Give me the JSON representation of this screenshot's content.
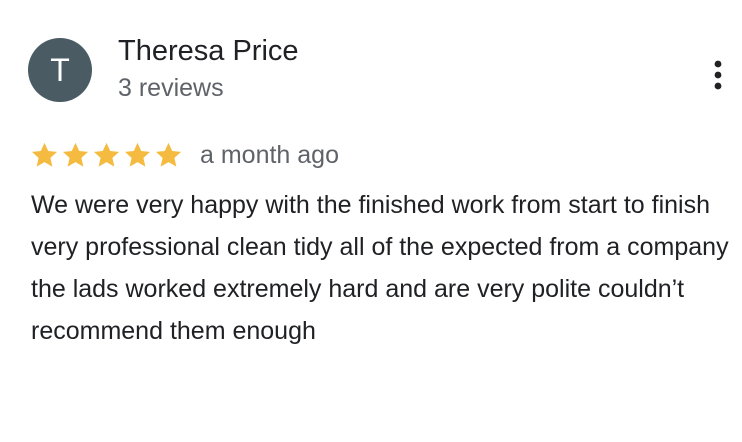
{
  "reviewer": {
    "initial": "T",
    "name": "Theresa Price",
    "review_count": "3 reviews",
    "avatar_color": "#4a5b64"
  },
  "menu": {
    "icon": "more-vert-icon"
  },
  "rating": {
    "stars": 5,
    "max_stars": 5,
    "star_color": "#f5bb41",
    "date": "a month ago"
  },
  "review": {
    "text": "We were very happy with the finished work from start to finish very professional clean tidy all of the expected from a company the lads worked extremely hard and are very polite couldn’t recommend them enough"
  }
}
